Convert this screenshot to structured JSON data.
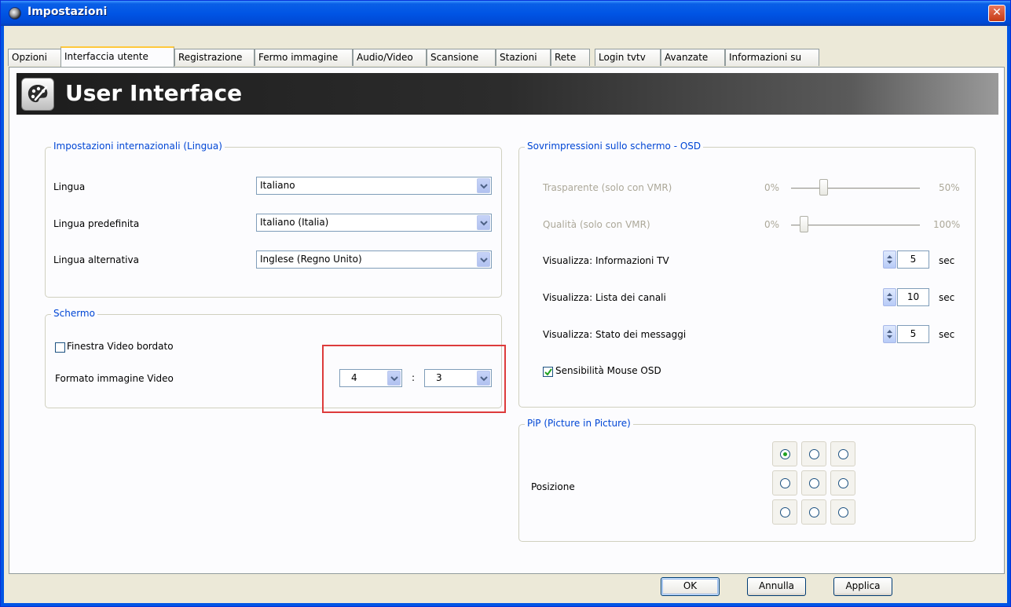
{
  "window": {
    "title": "Impostazioni",
    "close_glyph": "✕"
  },
  "tabs": [
    {
      "label": "Opzioni",
      "active": false
    },
    {
      "label": "Interfaccia utente",
      "active": true
    },
    {
      "label": "Registrazione",
      "active": false
    },
    {
      "label": "Fermo immagine",
      "active": false
    },
    {
      "label": "Audio/Video",
      "active": false
    },
    {
      "label": "Scansione",
      "active": false
    },
    {
      "label": "Stazioni",
      "active": false
    },
    {
      "label": "Rete",
      "active": false
    },
    {
      "label": "Login tvtv",
      "active": false
    },
    {
      "label": "Avanzate",
      "active": false
    },
    {
      "label": "Informazioni su",
      "active": false
    }
  ],
  "banner": {
    "title": "User Interface",
    "icon": "paint-palette-icon"
  },
  "language_group": {
    "legend": "Impostazioni internazionali (Lingua)",
    "rows": [
      {
        "label": "Lingua",
        "value": "Italiano"
      },
      {
        "label": "Lingua predefinita",
        "value": "Italiano (Italia)"
      },
      {
        "label": "Lingua alternativa",
        "value": "Inglese (Regno Unito)"
      }
    ]
  },
  "screen_group": {
    "legend": "Schermo",
    "bordered_window_label": "Finestra Video bordato",
    "bordered_window_checked": false,
    "aspect_label": "Formato immagine Video",
    "aspect_w": "4",
    "aspect_sep": ":",
    "aspect_h": "3"
  },
  "osd_group": {
    "legend": "Sovrimpressioni sullo schermo - OSD",
    "transparency": {
      "label": "Trasparente (solo con VMR)",
      "min": "0%",
      "max": "50%",
      "level": 0.25,
      "enabled": false
    },
    "quality": {
      "label": "Qualità (solo con VMR)",
      "min": "0%",
      "max": "100%",
      "level": 0.1,
      "enabled": false
    },
    "displays": [
      {
        "label": "Visualizza: Informazioni TV",
        "value": "5",
        "unit": "sec"
      },
      {
        "label": "Visualizza: Lista dei canali",
        "value": "10",
        "unit": "sec"
      },
      {
        "label": "Visualizza: Stato dei messaggi",
        "value": "5",
        "unit": "sec"
      }
    ],
    "mouse_sensitivity_label": "Sensibilità Mouse OSD",
    "mouse_sensitivity_checked": true
  },
  "pip_group": {
    "legend": "PiP (Picture in Picture)",
    "position_label": "Posizione",
    "selected_cell": 0
  },
  "buttons": {
    "ok": "OK",
    "cancel": "Annulla",
    "apply": "Applica"
  },
  "colors": {
    "title_bar": "#0055e5",
    "legend_text": "#0046d5",
    "highlight_box": "#dd3b3b",
    "disabled_text": "#aca899"
  }
}
